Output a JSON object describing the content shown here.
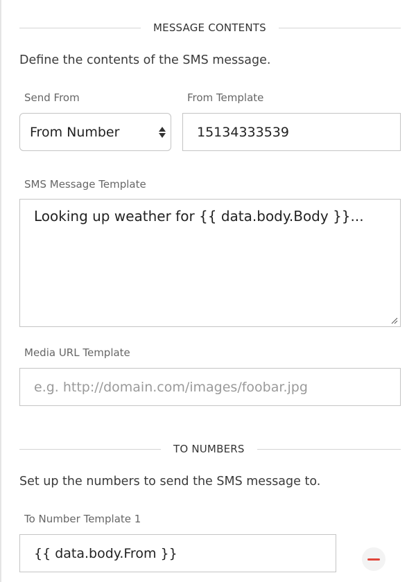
{
  "message_contents": {
    "section_title": "MESSAGE CONTENTS",
    "description": "Define the contents of the SMS message.",
    "send_from": {
      "label": "Send From",
      "selected": "From Number"
    },
    "from_template": {
      "label": "From Template",
      "value": "15134333539"
    },
    "sms_template": {
      "label": "SMS Message Template",
      "value": "Looking up weather for {{ data.body.Body }}..."
    },
    "media_url": {
      "label": "Media URL Template",
      "placeholder": "e.g. http://domain.com/images/foobar.jpg"
    }
  },
  "to_numbers": {
    "section_title": "TO NUMBERS",
    "description": "Set up the numbers to send the SMS message to.",
    "entries": [
      {
        "label": "To Number Template 1",
        "value": "{{ data.body.From }}"
      }
    ]
  },
  "colors": {
    "remove_icon": "#e0453a",
    "border": "#c4c4c4"
  },
  "icons": {
    "select_arrows": "up-down-chevron-icon",
    "remove": "minus-circle-icon",
    "resize": "resize-handle-icon"
  }
}
